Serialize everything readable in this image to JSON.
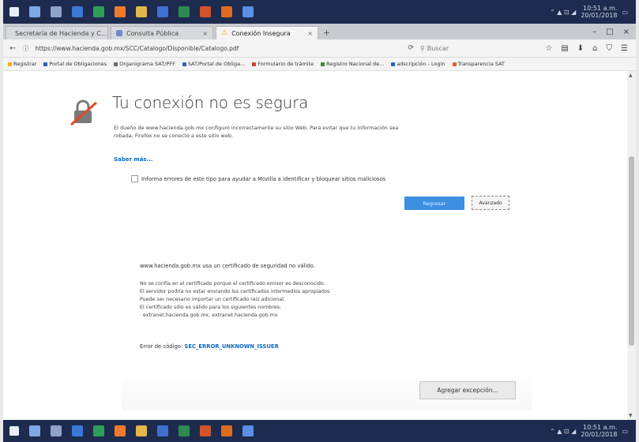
{
  "taskbar": {
    "icons": [
      "windows-icon",
      "cortana-icon",
      "task-view-icon",
      "app-icon",
      "chrome-icon",
      "firefox-icon",
      "explorer-icon",
      "store-icon",
      "excel-icon",
      "powerpoint-icon",
      "office-icon",
      "vpn-icon"
    ],
    "icon_colors": [
      "#e8edf7",
      "#7fa8e6",
      "#8fa3c8",
      "#3a78d8",
      "#2f9e57",
      "#f07a2a",
      "#e2b84c",
      "#3f6fd1",
      "#2d8a4e",
      "#d0532b",
      "#e06b1f",
      "#5b8ee6"
    ],
    "tray_time": "10:51 a.m.",
    "tray_date": "20/01/2018"
  },
  "tabs": [
    {
      "label": "Secretaría de Hacienda y C...",
      "active": false,
      "color": "#e05a2a"
    },
    {
      "label": "Consulta Pública",
      "active": false,
      "color": "#6b8cc9"
    },
    {
      "label": "Conexión Insegura",
      "active": true,
      "color": "#e0a020"
    }
  ],
  "newtab_label": "+",
  "nav": {
    "url": "https://www.hacienda.gob.mx/SCC/Catalogo/Disponible/Catalogo.pdf",
    "search_placeholder": "Buscar"
  },
  "bookmarks": [
    {
      "label": "Registrar",
      "color": "#f0b000"
    },
    {
      "label": "Portal de Obligaciones",
      "color": "#2d62b8"
    },
    {
      "label": "Organigrama SAT/PFF",
      "color": "#6a6a6a"
    },
    {
      "label": "SAT/Portal de Obliga...",
      "color": "#2d62b8"
    },
    {
      "label": "Formulario de trámite",
      "color": "#d04040"
    },
    {
      "label": "Registro Nacional de...",
      "color": "#3c8c3c"
    },
    {
      "label": "adscripción - Login",
      "color": "#2d62b8"
    },
    {
      "label": "Transparencia SAT",
      "color": "#e06020"
    }
  ],
  "page": {
    "title": "Tu conexión no es segura",
    "desc_line1": "El dueño de www.hacienda.gob.mx configuró incorrectamente su sitio Web. Para evitar que tu información sea",
    "desc_line2": "robada, Firefox no se conectó a este sitio web.",
    "learn_more": "Saber más...",
    "report_label": "Informa errores de este tipo para ayudar a Mozilla a identificar y bloquear sitios maliciosos",
    "back_button": "Regresar",
    "advanced_button": "Avanzado",
    "adv_intro": "www.hacienda.gob.mx usa un certificado de seguridad no válido.",
    "adv_lines": [
      "No se confía en el certificado porque el certificado emisor es desconocido.",
      "El servidor podría no estar enviando los certificados intermedios apropiados.",
      "Puede ser necesario importar un certificado raíz adicional.",
      "El certificado sólo es válido para los siguientes nombres:",
      "  extranet.hacienda.gob.mx, extranet.hacienda.gob.mx"
    ],
    "error_label": "Error de código:",
    "error_code": "SEC_ERROR_UNKNOWN_ISSUER",
    "exception_button": "Agregar excepción..."
  }
}
